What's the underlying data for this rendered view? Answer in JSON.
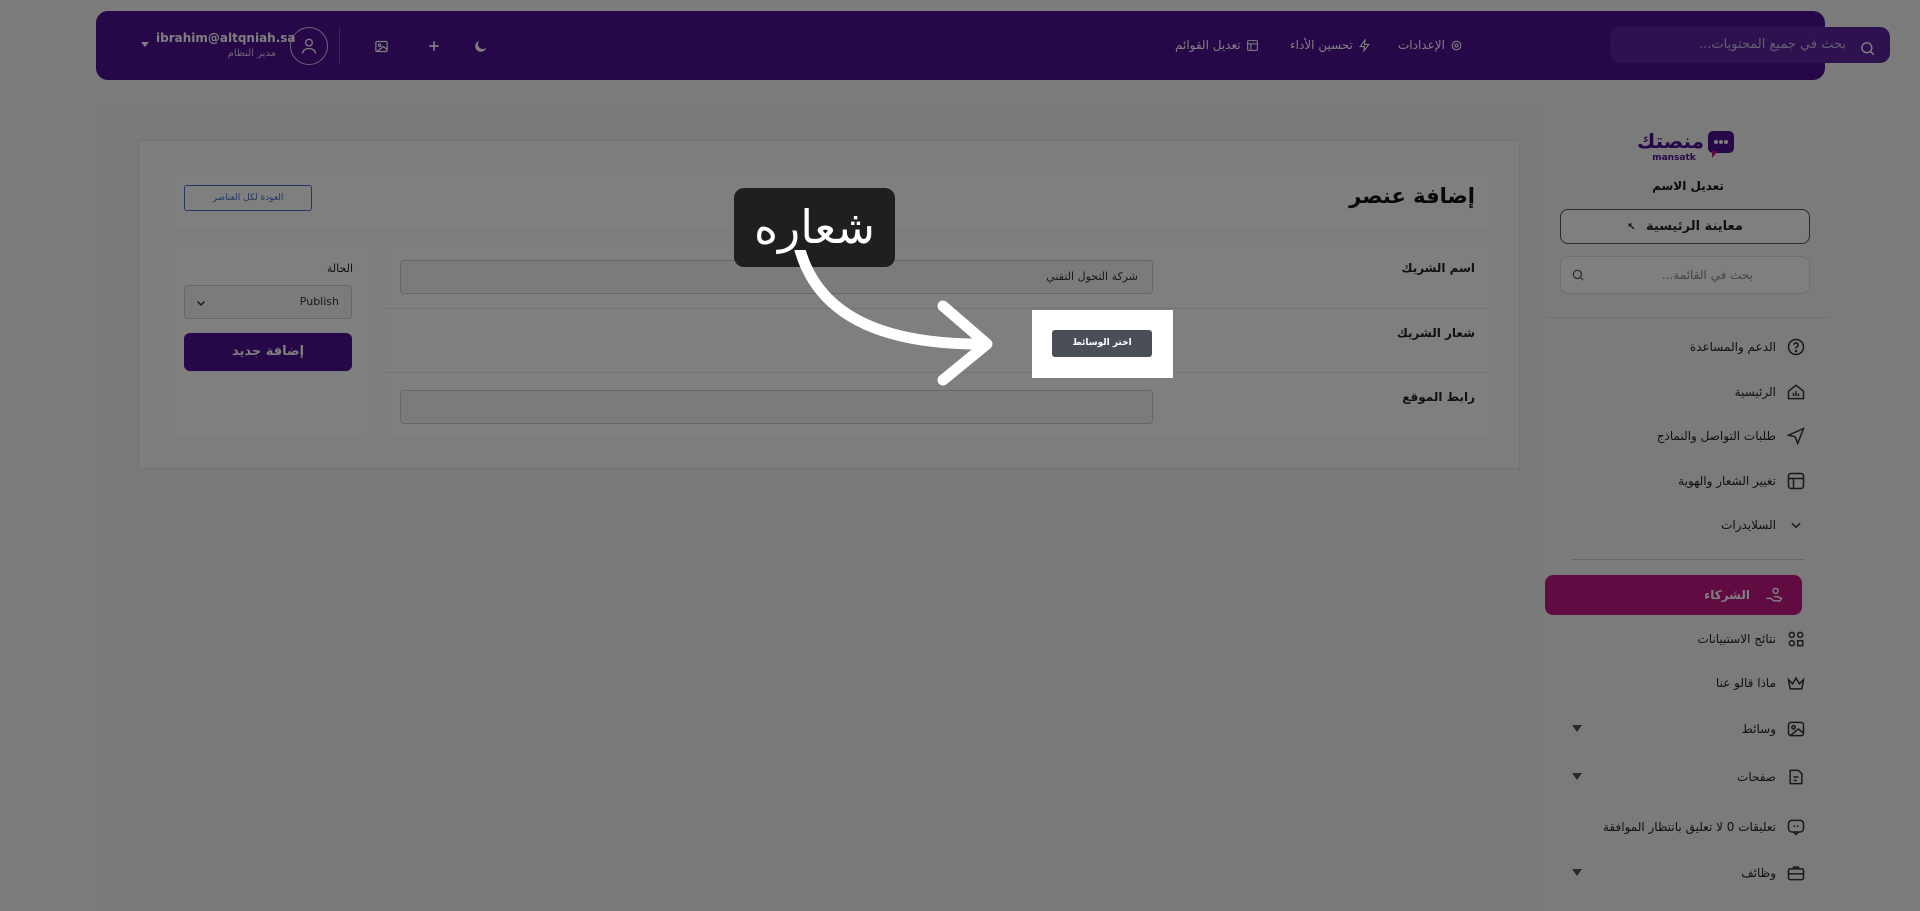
{
  "topbar": {
    "search_placeholder": "بحث في جميع المحتويات...",
    "nav": {
      "settings": "الإعدادات",
      "performance": "تحسين الأداء",
      "edit_menus": "تعديل القوائم"
    },
    "user": {
      "email": "ibrahim@altqniah.sa",
      "role": "مدير النظام"
    }
  },
  "sidebar": {
    "logo_text": "منصتك",
    "logo_sub": "mansatk",
    "edit_name": "تعديل الاسم",
    "preview_label": "معاينة الرئيسية",
    "search_placeholder": "بحث في القائمة...",
    "items": [
      {
        "label": "الدعم والمساعدة",
        "icon": "help-circle-icon"
      },
      {
        "label": "الرئيسية",
        "icon": "home-chart-icon"
      },
      {
        "label": "طلبات التواصل والنماذج",
        "icon": "send-icon"
      },
      {
        "label": "تغيير الشعار والهوية",
        "icon": "layout-icon"
      },
      {
        "label": "السلايدرات",
        "icon": "chevron-down-icon"
      },
      {
        "label": "الشركاء",
        "icon": "handshake-icon",
        "active": true
      },
      {
        "label": "نتائج الاستبيانات",
        "icon": "shapes-icon"
      },
      {
        "label": "ماذا قالو عنا",
        "icon": "crown-icon"
      },
      {
        "label": "وسائط",
        "icon": "image-icon"
      },
      {
        "label": "صفحات",
        "icon": "pages-icon"
      },
      {
        "label": "تعليقات 0 لا تعليق بانتظار الموافقة",
        "icon": "comment-icon"
      },
      {
        "label": "وظائف",
        "icon": "briefcase-icon"
      }
    ]
  },
  "main": {
    "title": "إضافة عنصر",
    "back_label": "العودة لكل العناصر",
    "form": {
      "partner_name_label": "اسم الشريك",
      "partner_name_value": "شركة التحول التقني",
      "partner_logo_label": "شعار الشريك",
      "website_label": "رابط الموقع",
      "website_value": ""
    },
    "status_label": "الحالة",
    "status_value": "Publish",
    "add_button": "إضافة جديد"
  },
  "tutorial": {
    "tooltip_text": "شعاره",
    "media_button": "اختر الوسائط"
  },
  "colors": {
    "brand": "#4c0e8f",
    "active_item": "#c01682",
    "link": "#4a6ec8"
  }
}
